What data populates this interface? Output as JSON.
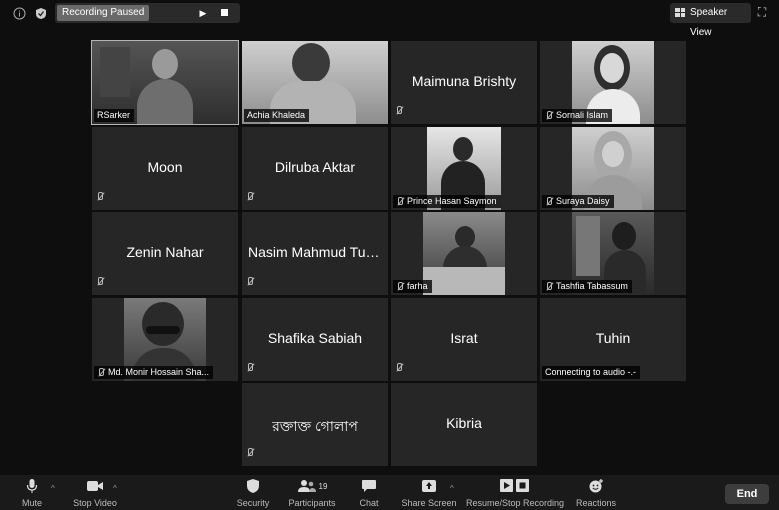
{
  "top_bar": {
    "recording_status": "Recording Paused",
    "view_button": "Speaker View"
  },
  "tiles": {
    "rsarker": "RSarker",
    "achia": "Achia Khaleda",
    "maimuna": "Maimuna Brishty",
    "sornali": "Sornali Islam",
    "moon": "Moon",
    "dilruba": "Dilruba Aktar",
    "prince": "Prince Hasan Saymon",
    "suraya": "Suraya Daisy",
    "zenin": "Zenin Nahar",
    "nasim": "Nasim Mahmud Tus...",
    "farha": "farha",
    "tashfia": "Tashfia Tabassum",
    "monir": "Md. Monir Hossain Sha...",
    "shafika": "Shafika Sabiah",
    "israt": "Israt",
    "tuhin": "Tuhin",
    "tuhin_status": "Connecting to audio -.-",
    "bangla": "রক্তাক্ত গোলাপ",
    "kibria": "Kibria"
  },
  "toolbar": {
    "mute": "Mute",
    "stop_video": "Stop Video",
    "security": "Security",
    "participants": "Participants",
    "participants_count": "19",
    "chat": "Chat",
    "share_screen": "Share Screen",
    "resume_stop_recording": "Resume/Stop Recording",
    "reactions": "Reactions",
    "end": "End"
  }
}
